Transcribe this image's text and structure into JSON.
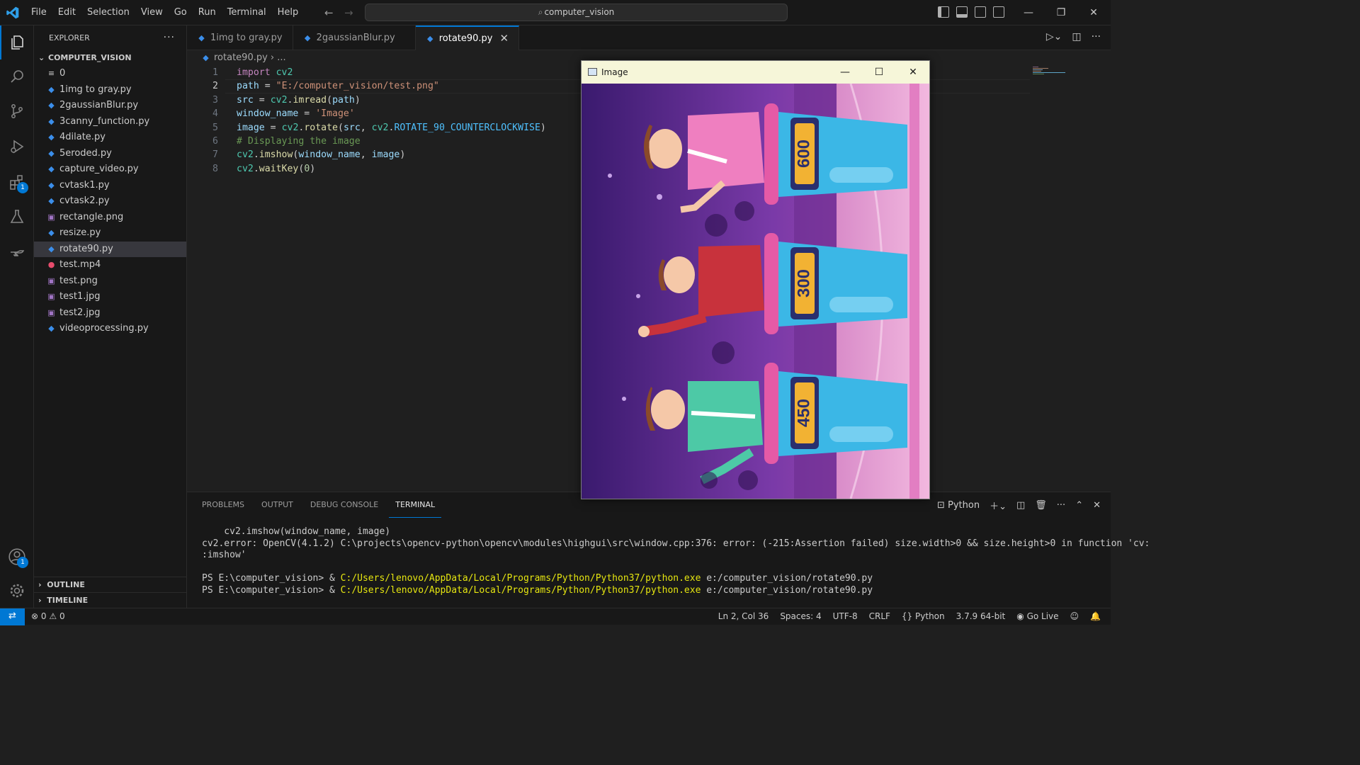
{
  "titlebar": {
    "menu": [
      "File",
      "Edit",
      "Selection",
      "View",
      "Go",
      "Run",
      "Terminal",
      "Help"
    ],
    "search": "computer_vision"
  },
  "sidebar": {
    "header": "EXPLORER",
    "folder": "COMPUTER_VISION",
    "files": [
      {
        "name": "0",
        "icon": "lines-icon",
        "type": "plain"
      },
      {
        "name": "1img to gray.py",
        "type": "py"
      },
      {
        "name": "2gaussianBlur.py",
        "type": "py"
      },
      {
        "name": "3canny_function.py",
        "type": "py"
      },
      {
        "name": "4dilate.py",
        "type": "py"
      },
      {
        "name": "5eroded.py",
        "type": "py"
      },
      {
        "name": "capture_video.py",
        "type": "py"
      },
      {
        "name": "cvtask1.py",
        "type": "py"
      },
      {
        "name": "cvtask2.py",
        "type": "py"
      },
      {
        "name": "rectangle.png",
        "type": "img"
      },
      {
        "name": "resize.py",
        "type": "py"
      },
      {
        "name": "rotate90.py",
        "type": "py",
        "selected": true
      },
      {
        "name": "test.mp4",
        "type": "vid"
      },
      {
        "name": "test.png",
        "type": "img"
      },
      {
        "name": "test1.jpg",
        "type": "img"
      },
      {
        "name": "test2.jpg",
        "type": "img"
      },
      {
        "name": "videoprocessing.py",
        "type": "py"
      }
    ],
    "outline": "OUTLINE",
    "timeline": "TIMELINE"
  },
  "activity": {
    "extensions_badge": "1",
    "accounts_badge": "1"
  },
  "tabs": [
    {
      "label": "1img to gray.py",
      "active": false
    },
    {
      "label": "2gaussianBlur.py",
      "active": false
    },
    {
      "label": "rotate90.py",
      "active": true
    }
  ],
  "editor": {
    "breadcrumb_file": "rotate90.py",
    "breadcrumb_rest": "...",
    "line_numbers": [
      "1",
      "2",
      "3",
      "4",
      "5",
      "6",
      "7",
      "8"
    ],
    "code": [
      "import cv2",
      "path = \"E:/computer_vision/test.png\"",
      "src = cv2.imread(path)",
      "window_name = 'Image'",
      "image = cv2.rotate(src, cv2.ROTATE_90_COUNTERCLOCKWISE)",
      "# Displaying the image",
      "cv2.imshow(window_name, image)",
      "cv2.waitKey(0)"
    ]
  },
  "panel": {
    "tabs": [
      "PROBLEMS",
      "OUTPUT",
      "DEBUG CONSOLE",
      "TERMINAL"
    ],
    "active_tab": "TERMINAL",
    "shell": "Python",
    "terminal": {
      "l1": "    cv2.imshow(window_name, image)",
      "l2": "cv2.error: OpenCV(4.1.2) C:\\projects\\opencv-python\\opencv\\modules\\highgui\\src\\window.cpp:376: error: (-215:Assertion failed) size.width>0 && size.height>0 in function 'cv:",
      "l3": ":imshow'",
      "prompt": "PS E:\\computer_vision> & ",
      "exe": "C:/Users/lenovo/AppData/Local/Programs/Python/Python37/python.exe",
      "arg": " e:/computer_vision/rotate90.py"
    }
  },
  "statusbar": {
    "errors": "0",
    "warnings": "0",
    "position": "Ln 2, Col 36",
    "spaces": "Spaces: 4",
    "encoding": "UTF-8",
    "eol": "CRLF",
    "language": "Python",
    "interpreter": "3.7.9 64-bit",
    "golive": "Go Live"
  },
  "image_window": {
    "title": "Image",
    "scores": [
      "600",
      "300",
      "450"
    ]
  }
}
